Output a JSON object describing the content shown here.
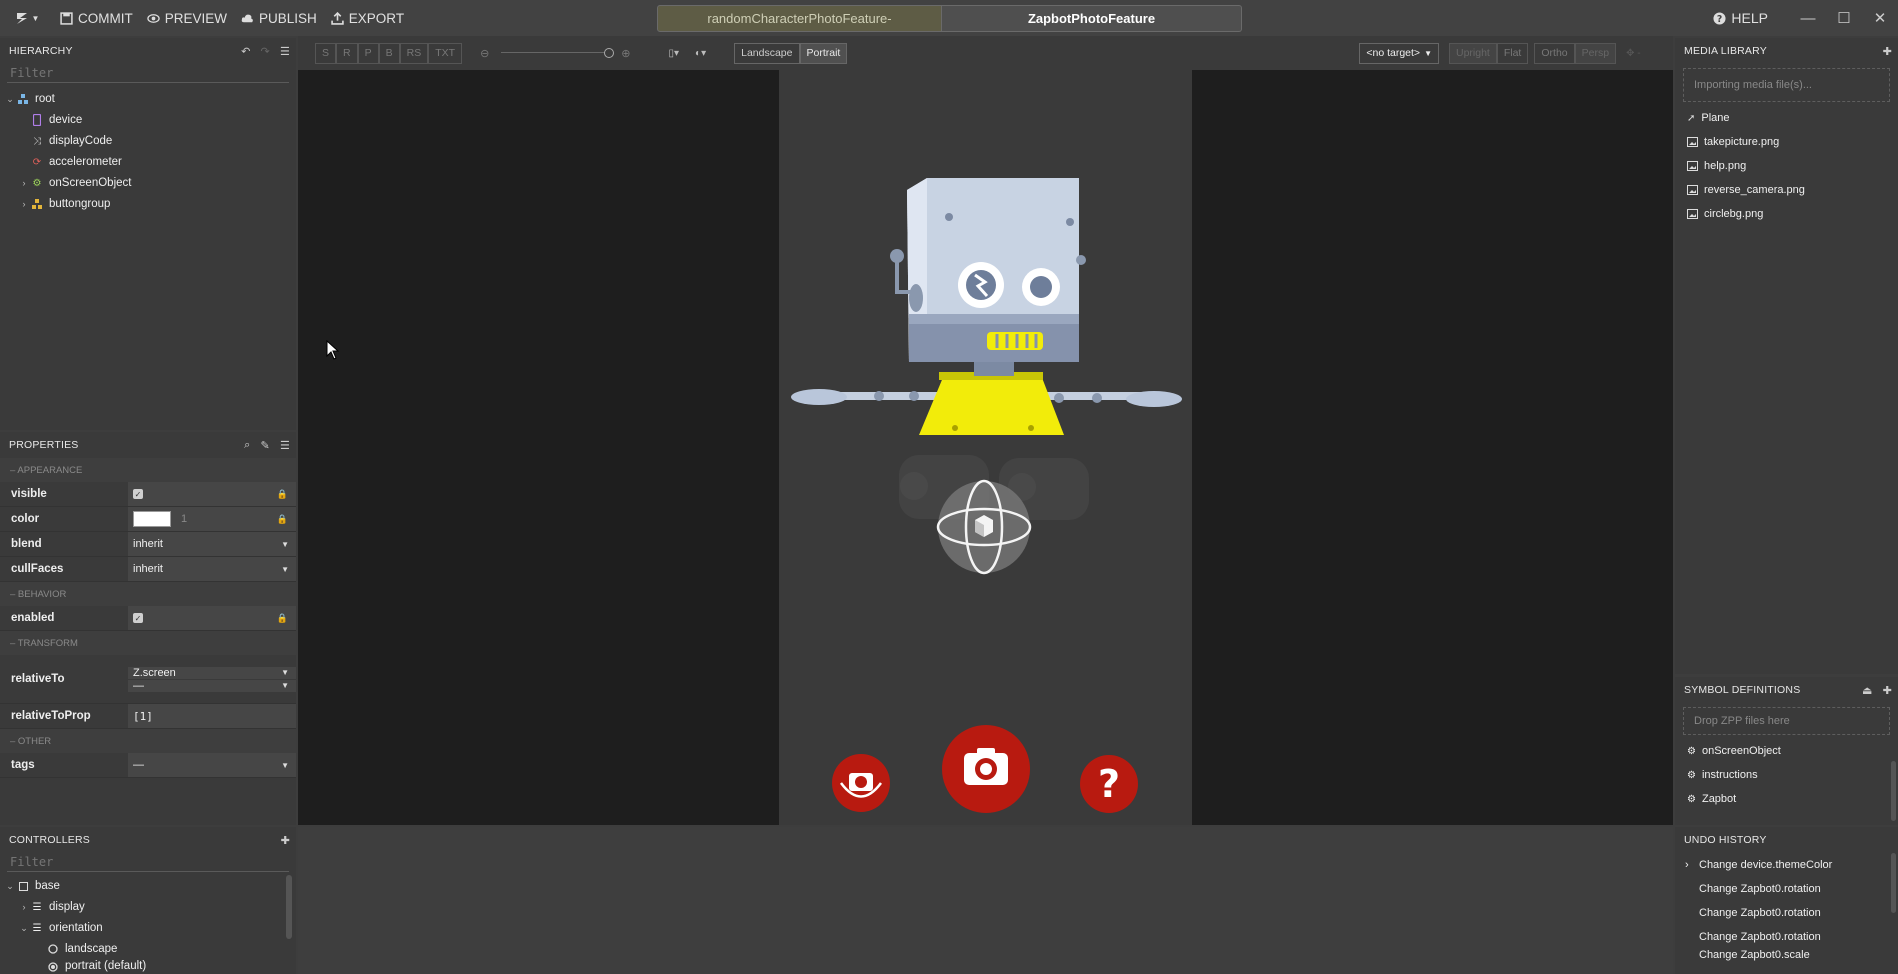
{
  "toolbar": {
    "commit": "COMMIT",
    "preview": "PREVIEW",
    "publish": "PUBLISH",
    "export": "EXPORT",
    "help": "HELP"
  },
  "tabs": [
    {
      "label": "randomCharacterPhotoFeature-",
      "active": false
    },
    {
      "label": "ZapbotPhotoFeature",
      "active": true
    }
  ],
  "hierarchy": {
    "title": "HIERARCHY",
    "filter_placeholder": "Filter",
    "items": [
      {
        "label": "root",
        "icon": "cube-group-icon",
        "depth": 0,
        "expanded": true
      },
      {
        "label": "device",
        "icon": "phone-icon",
        "depth": 1
      },
      {
        "label": "displayCode",
        "icon": "shuffle-icon",
        "depth": 1
      },
      {
        "label": "accelerometer",
        "icon": "sync-icon",
        "depth": 1
      },
      {
        "label": "onScreenObject",
        "icon": "gear-icon",
        "depth": 1,
        "collapsed": true
      },
      {
        "label": "buttongroup",
        "icon": "group-icon",
        "depth": 1,
        "collapsed": true
      }
    ]
  },
  "properties": {
    "title": "PROPERTIES",
    "sections": {
      "appearance": "– APPEARANCE",
      "behavior": "– BEHAVIOR",
      "transform": "– TRANSFORM",
      "other": "– OTHER"
    },
    "visible": {
      "label": "visible",
      "checked": true
    },
    "color": {
      "label": "color",
      "swatch": "#ffffff",
      "alpha": "1"
    },
    "blend": {
      "label": "blend",
      "value": "inherit"
    },
    "cullFaces": {
      "label": "cullFaces",
      "value": "inherit"
    },
    "enabled": {
      "label": "enabled",
      "checked": true
    },
    "relativeTo": {
      "label": "relativeTo",
      "value1": "Z.screen",
      "value2": "—"
    },
    "relativeToProp": {
      "label": "relativeToProp",
      "value": "[1]"
    },
    "tags": {
      "label": "tags",
      "value": "—"
    }
  },
  "controllers": {
    "title": "CONTROLLERS",
    "filter_placeholder": "Filter",
    "items": [
      {
        "label": "base",
        "icon": "square-icon"
      },
      {
        "label": "display",
        "icon": "list-icon"
      },
      {
        "label": "orientation",
        "icon": "list-icon"
      },
      {
        "label": "landscape",
        "icon": "radio-icon"
      },
      {
        "label": "portrait (default)",
        "icon": "radio-checked-icon"
      }
    ]
  },
  "viewport_toolbar": {
    "buttons": [
      "S",
      "R",
      "P",
      "B",
      "RS",
      "TXT"
    ],
    "landscape": "Landscape",
    "portrait": "Portrait",
    "target": "<no target>",
    "view_buttons": [
      "Upright",
      "Flat"
    ],
    "proj_buttons": [
      "Ortho",
      "Persp"
    ]
  },
  "media_library": {
    "title": "MEDIA LIBRARY",
    "dropzone": "Importing media file(s)...",
    "items": [
      {
        "label": "Plane",
        "icon": "rocket-icon"
      },
      {
        "label": "takepicture.png",
        "icon": "image-icon"
      },
      {
        "label": "help.png",
        "icon": "image-icon"
      },
      {
        "label": "reverse_camera.png",
        "icon": "image-icon"
      },
      {
        "label": "circlebg.png",
        "icon": "image-icon"
      }
    ]
  },
  "symbols": {
    "title": "SYMBOL DEFINITIONS",
    "dropzone": "Drop ZPP files here",
    "items": [
      "onScreenObject",
      "instructions",
      "Zapbot"
    ]
  },
  "undo": {
    "title": "UNDO HISTORY",
    "items": [
      "Change device.themeColor",
      "Change Zapbot0.rotation",
      "Change Zapbot0.rotation",
      "Change Zapbot0.rotation",
      "Change Zapbot0.scale"
    ]
  },
  "colors": {
    "accent_red": "#b81a10",
    "robot_body": "#c8d3e3",
    "robot_yellow": "#f2ec0a"
  }
}
